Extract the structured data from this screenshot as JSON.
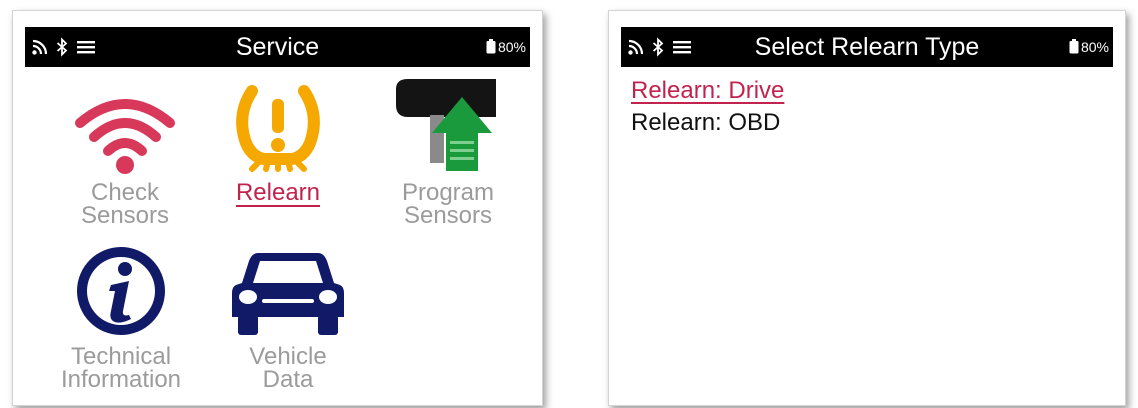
{
  "left_screen": {
    "status_bar": {
      "title": "Service",
      "battery": "80%",
      "icons": [
        "wifi-icon",
        "bluetooth-icon",
        "menu-icon",
        "battery-icon"
      ]
    },
    "tiles": [
      {
        "line1": "Check",
        "line2": "Sensors",
        "icon": "wifi-signal-icon",
        "selected": false
      },
      {
        "line1": "Relearn",
        "line2": "",
        "icon": "tpms-warning-icon",
        "selected": true
      },
      {
        "line1": "Program",
        "line2": "Sensors",
        "icon": "sensor-upload-icon",
        "selected": false
      },
      {
        "line1": "Technical",
        "line2": "Information",
        "icon": "info-icon",
        "selected": false
      },
      {
        "line1": "Vehicle",
        "line2": "Data",
        "icon": "car-icon",
        "selected": false
      }
    ]
  },
  "right_screen": {
    "status_bar": {
      "title": "Select Relearn Type",
      "battery": "80%",
      "icons": [
        "wifi-icon",
        "bluetooth-icon",
        "menu-icon",
        "battery-icon"
      ]
    },
    "options": [
      {
        "label": "Relearn: Drive",
        "selected": true
      },
      {
        "label": "Relearn: OBD",
        "selected": false
      }
    ]
  },
  "colors": {
    "accent": "#c2234d",
    "wifi_red": "#d8385a",
    "tpms_amber": "#f5a800",
    "navy": "#101a66",
    "upload_green": "#1a9a3c",
    "inactive_text": "#9b9b9b",
    "statusbar_bg": "#000000"
  }
}
